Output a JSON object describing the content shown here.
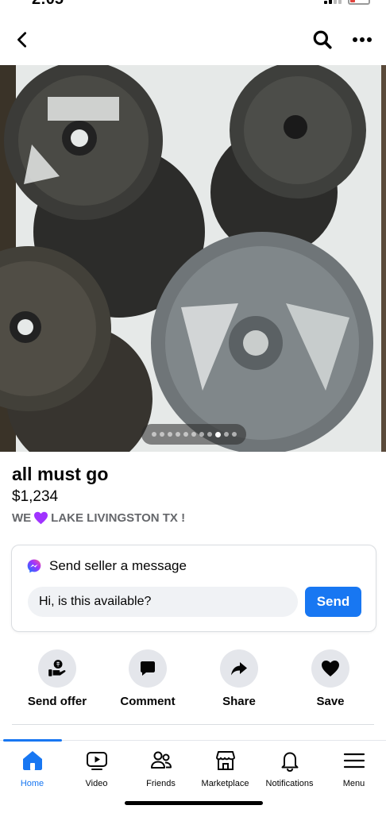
{
  "status": {
    "time": "2:05"
  },
  "listing": {
    "title": "all must go",
    "price": "$1,234",
    "location_prefix": "WE",
    "location_suffix": "LAKE LIVINGSTON TX !",
    "photo_count": 11,
    "current_photo": 9
  },
  "message": {
    "heading": "Send seller a message",
    "input_value": "Hi, is this available?",
    "send_label": "Send"
  },
  "actions": [
    {
      "label": "Send offer",
      "icon": "offer-icon"
    },
    {
      "label": "Comment",
      "icon": "comment-icon"
    },
    {
      "label": "Share",
      "icon": "share-icon"
    },
    {
      "label": "Save",
      "icon": "heart-icon"
    }
  ],
  "tabs": [
    {
      "label": "Home",
      "icon": "home-icon",
      "active": true
    },
    {
      "label": "Video",
      "icon": "video-icon"
    },
    {
      "label": "Friends",
      "icon": "friends-icon"
    },
    {
      "label": "Marketplace",
      "icon": "marketplace-icon"
    },
    {
      "label": "Notifications",
      "icon": "bell-icon"
    },
    {
      "label": "Menu",
      "icon": "menu-icon"
    }
  ],
  "colors": {
    "accent": "#1877f2",
    "heart": "#a033ff"
  }
}
